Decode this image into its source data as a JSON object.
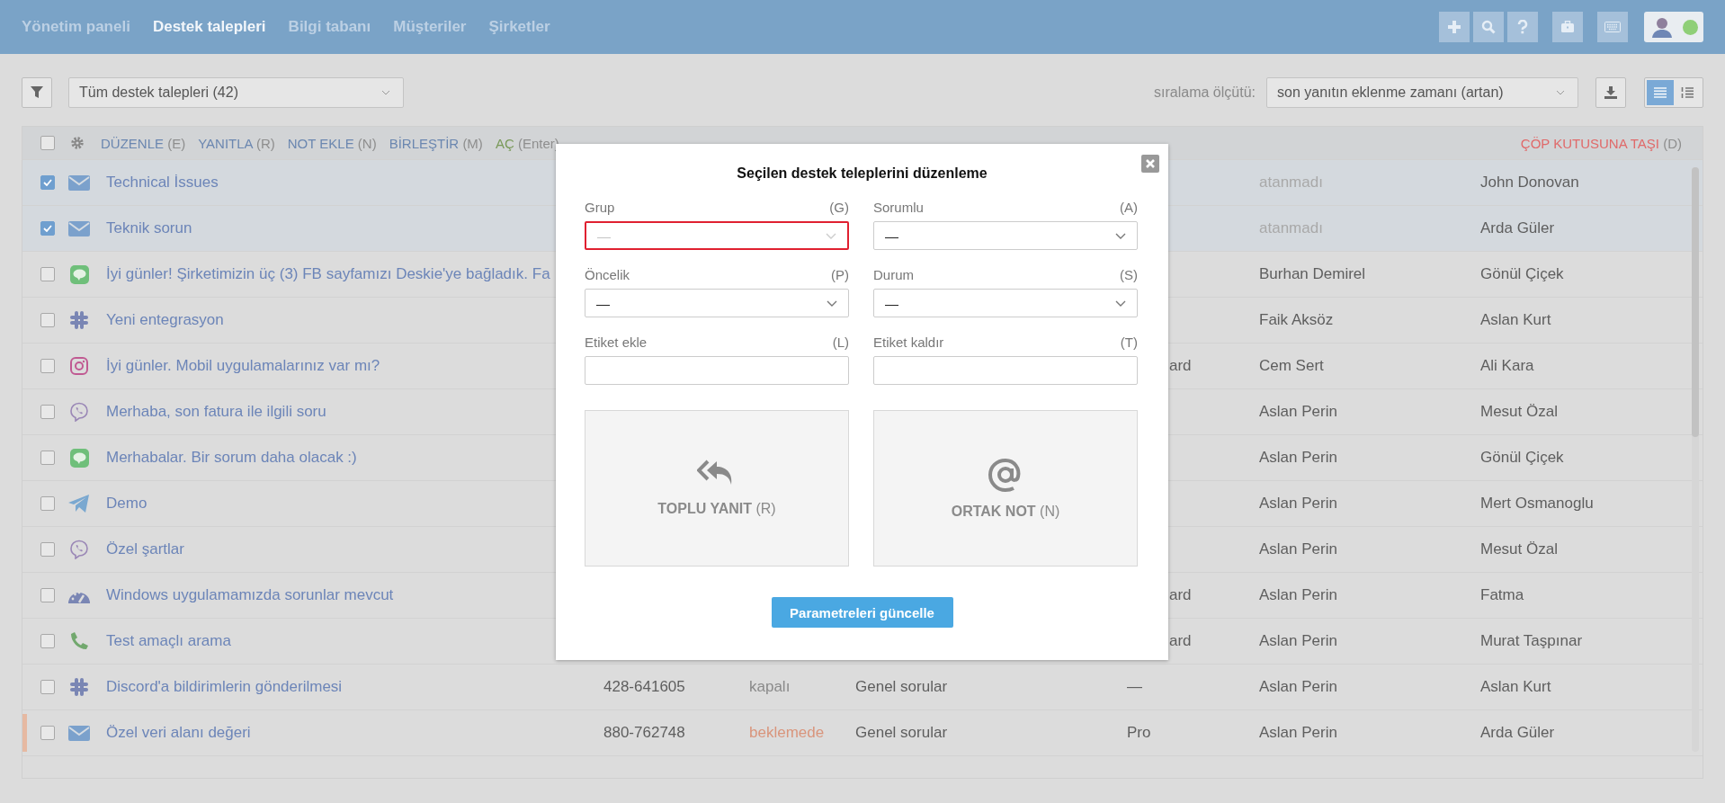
{
  "nav": {
    "items": [
      {
        "label": "Yönetim paneli",
        "selected": false
      },
      {
        "label": "Destek talepleri",
        "selected": true
      },
      {
        "label": "Bilgi tabanı",
        "selected": false
      },
      {
        "label": "Müşteriler",
        "selected": false
      },
      {
        "label": "Şirketler",
        "selected": false
      }
    ],
    "tools": [
      {
        "kind": "plus"
      },
      {
        "kind": "search"
      },
      {
        "kind": "help"
      },
      {
        "kind": "briefcase"
      },
      {
        "kind": "keyboard"
      }
    ],
    "user": {
      "online": true
    }
  },
  "toolbar": {
    "filter": "Tüm destek talepleri (42)",
    "sort_label": "sıralama ölçütü:",
    "sort": "son yanıtın eklenme zamanı (artan)",
    "views": [
      {
        "kind": "list",
        "selected": true
      },
      {
        "kind": "compact",
        "selected": false
      }
    ]
  },
  "actions": {
    "all_checked": false,
    "items": [
      {
        "label": "DÜZENLE",
        "key": "(E)",
        "kind": "normal"
      },
      {
        "label": "YANITLA",
        "key": "(R)",
        "kind": "normal"
      },
      {
        "label": "NOT EKLE",
        "key": "(N)",
        "kind": "normal"
      },
      {
        "label": "BİRLEŞTİR",
        "key": "(M)",
        "kind": "normal"
      },
      {
        "label": "AÇ",
        "key": "(Enter)",
        "kind": "open"
      }
    ],
    "trash": {
      "label": "ÇÖP KUTUSUNA TAŞI",
      "key": "(D)"
    }
  },
  "tickets": [
    {
      "selected": true,
      "flagged": false,
      "kind": "email",
      "subject": "Technical İssues",
      "assigned": false,
      "assignee": "atanmadı",
      "customer": "John Donovan"
    },
    {
      "selected": true,
      "flagged": false,
      "kind": "email",
      "subject": "Teknik sorun",
      "assigned": false,
      "assignee": "atanmadı",
      "customer": "Arda Güler"
    },
    {
      "selected": false,
      "flagged": false,
      "kind": "line",
      "subject": "İyi günler! Şirketimizin üç (3) FB sayfamızı Deskie'ye bağladık. Fa",
      "assigned": true,
      "assignee": "Burhan Demirel",
      "customer": "Gönül Çiçek"
    },
    {
      "selected": false,
      "flagged": false,
      "kind": "slack",
      "subject": "Yeni entegrasyon",
      "assigned": true,
      "assignee": "Faik Aksöz",
      "customer": "Aslan Kurt"
    },
    {
      "selected": false,
      "flagged": false,
      "kind": "instagram",
      "subject": "İyi günler. Mobil uygulamalarınız var mı?",
      "plan": "ard",
      "assigned": true,
      "assignee": "Cem Sert",
      "customer": "Ali Kara"
    },
    {
      "selected": false,
      "flagged": false,
      "kind": "viber",
      "subject": "Merhaba, son fatura ile ilgili soru",
      "assigned": true,
      "assignee": "Aslan Perin",
      "customer": "Mesut Özal"
    },
    {
      "selected": false,
      "flagged": false,
      "kind": "line",
      "subject": "Merhabalar. Bir sorum daha olacak :)",
      "assigned": true,
      "assignee": "Aslan Perin",
      "customer": "Gönül Çiçek"
    },
    {
      "selected": false,
      "flagged": false,
      "kind": "telegram",
      "subject": "Demo",
      "assigned": true,
      "assignee": "Aslan Perin",
      "customer": "Mert Osmanoglu"
    },
    {
      "selected": false,
      "flagged": false,
      "kind": "viber",
      "subject": "Özel şartlar",
      "assigned": true,
      "assignee": "Aslan Perin",
      "customer": "Mesut Özal"
    },
    {
      "selected": false,
      "flagged": false,
      "kind": "widget",
      "subject": "Windows uygulamamızda sorunlar mevcut",
      "plan": "ard",
      "assigned": true,
      "assignee": "Aslan Perin",
      "customer": "Fatma"
    },
    {
      "selected": false,
      "flagged": false,
      "kind": "phone",
      "subject": "Test amaçlı arama",
      "plan": "ard",
      "assigned": true,
      "assignee": "Aslan Perin",
      "customer": "Murat Taşpınar"
    },
    {
      "selected": false,
      "flagged": false,
      "kind": "slack",
      "subject": "Discord'a bildirimlerin gönderilmesi",
      "number": "428-641605",
      "status": {
        "text": "kapalı",
        "kind": "closed"
      },
      "group": "Genel sorular",
      "plan": "—",
      "assigned": true,
      "assignee": "Aslan Perin",
      "customer": "Aslan Kurt"
    },
    {
      "selected": false,
      "flagged": true,
      "kind": "email",
      "subject": "Özel veri alanı değeri",
      "number": "880-762748",
      "status": {
        "text": "beklemede",
        "kind": "pending"
      },
      "group": "Genel sorular",
      "plan": "Pro",
      "assigned": true,
      "assignee": "Aslan Perin",
      "customer": "Arda Güler"
    }
  ],
  "modal": {
    "title": "Seçilen destek teleplerini düzenleme",
    "fields": [
      {
        "label": "Grup",
        "key": "(G)",
        "kind": "select",
        "placeholder": "—",
        "error": true
      },
      {
        "label": "Sorumlu",
        "key": "(A)",
        "kind": "select",
        "value": "—",
        "error": false
      },
      {
        "label": "Öncelik",
        "key": "(P)",
        "kind": "select",
        "value": "—",
        "error": false
      },
      {
        "label": "Durum",
        "key": "(S)",
        "kind": "select",
        "value": "—",
        "error": false
      },
      {
        "label": "Etiket ekle",
        "key": "(L)",
        "kind": "input",
        "error": false
      },
      {
        "label": "Etiket kaldır",
        "key": "(T)",
        "kind": "input",
        "error": false
      }
    ],
    "tiles": [
      {
        "kind": "reply",
        "label": "TOPLU YANIT",
        "key": "(R)"
      },
      {
        "kind": "note",
        "label": "ORTAK NOT",
        "key": "(N)"
      }
    ],
    "submit": "Parametreleri güncelle"
  }
}
